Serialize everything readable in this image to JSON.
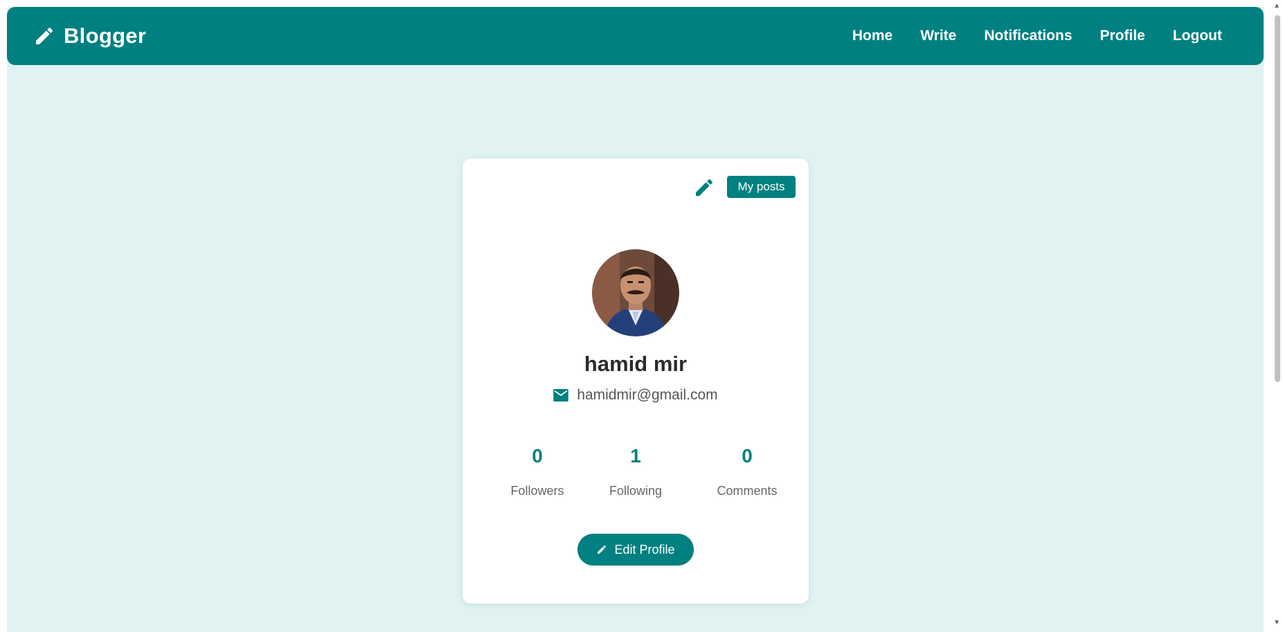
{
  "colors": {
    "primary": "#008080",
    "page_bg": "#e0f2f1",
    "card_bg": "#ffffff"
  },
  "navbar": {
    "brand": "Blogger",
    "brand_icon": "pencil-icon",
    "links": [
      "Home",
      "Write",
      "Notifications",
      "Profile",
      "Logout"
    ]
  },
  "profile": {
    "my_posts_label": "My posts",
    "edit_icon": "pencil-icon",
    "avatar_alt": "profile photo",
    "name": "hamid mir",
    "email_icon": "mail-icon",
    "email": "hamidmir@gmail.com",
    "stats": [
      {
        "value": "0",
        "label": "Followers"
      },
      {
        "value": "1",
        "label": "Following"
      },
      {
        "value": "0",
        "label": "Comments"
      }
    ],
    "edit_button_label": "Edit Profile"
  }
}
